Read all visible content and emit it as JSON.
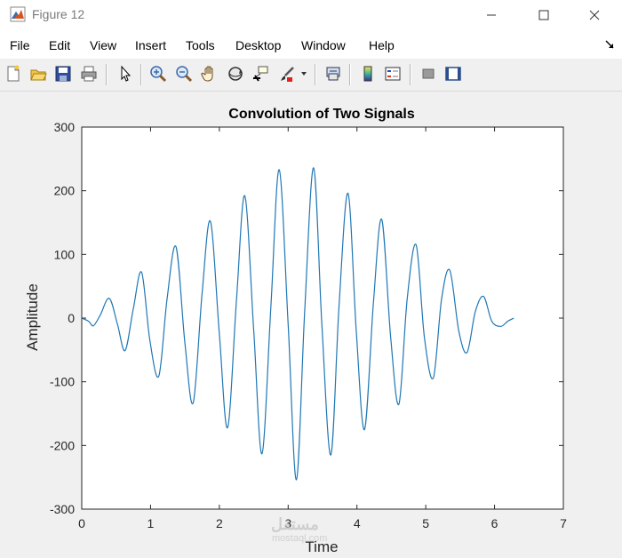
{
  "window": {
    "title": "Figure 12",
    "minimize_label": "Minimize",
    "maximize_label": "Maximize",
    "close_label": "Close"
  },
  "menu": [
    "File",
    "Edit",
    "View",
    "Insert",
    "Tools",
    "Desktop",
    "Window",
    "Help"
  ],
  "toolbar": {
    "icons": [
      "new-figure-icon",
      "open-file-icon",
      "save-icon",
      "print-icon",
      "edit-plot-pointer-icon",
      "zoom-in-icon",
      "zoom-out-icon",
      "pan-hand-icon",
      "rotate-3d-icon",
      "data-cursor-icon",
      "brush-icon",
      "brush-dropdown-icon",
      "link-plot-icon",
      "insert-colorbar-icon",
      "insert-legend-icon",
      "hide-plot-tools-icon",
      "show-plot-tools-icon"
    ]
  },
  "watermark": {
    "text": "مستقل",
    "sub": "mostaql.com"
  },
  "colors": {
    "line": "#1f77b4",
    "axes_bg": "#ffffff",
    "figure_bg": "#f0f0f0"
  },
  "chart_data": {
    "type": "line",
    "title": "Convolution of Two Signals",
    "xlabel": "Time",
    "ylabel": "Amplitude",
    "xlim": [
      0,
      7
    ],
    "ylim": [
      -300,
      300
    ],
    "xticks": [
      0,
      1,
      2,
      3,
      4,
      5,
      6,
      7
    ],
    "yticks": [
      -300,
      -200,
      -100,
      0,
      100,
      200,
      300
    ],
    "grid": false,
    "series": [
      {
        "x": [
          0,
          0.1,
          0.17,
          0.27,
          0.4,
          0.52,
          0.63,
          0.75,
          0.87,
          0.99,
          1.12,
          1.24,
          1.37,
          1.5,
          1.62,
          1.75,
          1.87,
          2.0,
          2.12,
          2.25,
          2.37,
          2.5,
          2.62,
          2.75,
          2.87,
          3.0,
          3.12,
          3.24,
          3.37,
          3.49,
          3.62,
          3.74,
          3.87,
          3.99,
          4.11,
          4.24,
          4.36,
          4.49,
          4.61,
          4.73,
          4.86,
          4.98,
          5.11,
          5.23,
          5.35,
          5.48,
          5.6,
          5.72,
          5.84,
          5.96,
          6.09,
          6.19,
          6.28
        ],
        "y": [
          0,
          -5,
          -12,
          5,
          31,
          -10,
          -51,
          15,
          72,
          -35,
          -91,
          30,
          112,
          -40,
          -133,
          40,
          152,
          -25,
          -172,
          30,
          192,
          -20,
          -213,
          20,
          233,
          -10,
          -254,
          10,
          236,
          -10,
          -215,
          20,
          196,
          -20,
          -175,
          25,
          155,
          -30,
          -135,
          30,
          115,
          -30,
          -94,
          30,
          75,
          -20,
          -54,
          10,
          34,
          -5,
          -13,
          -5,
          0
        ]
      }
    ]
  }
}
